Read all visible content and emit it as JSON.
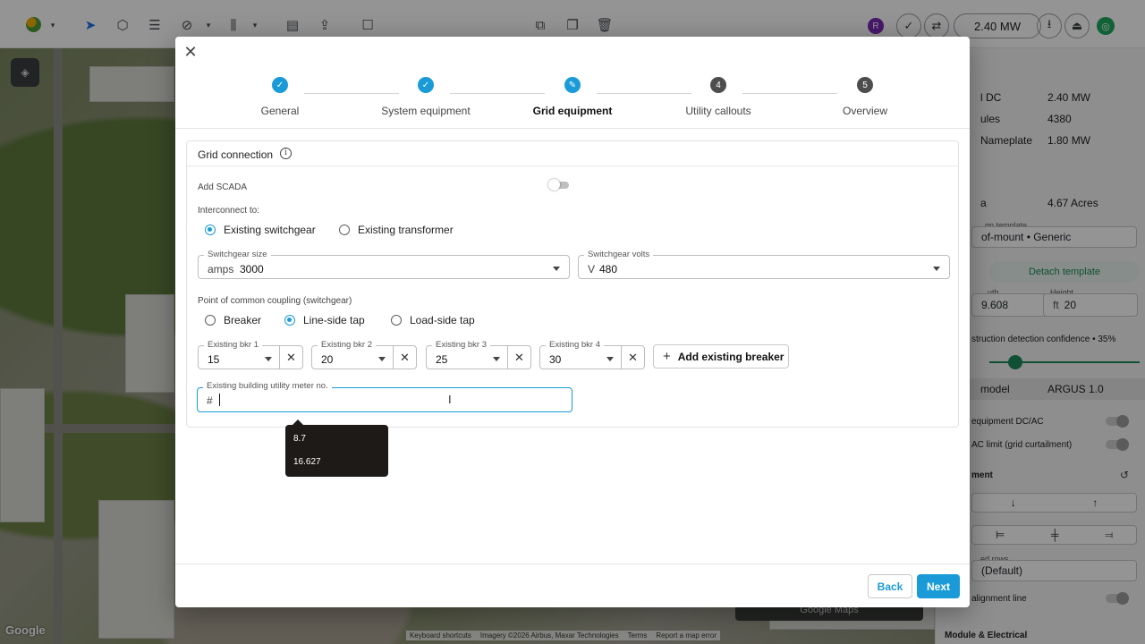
{
  "topbar": {
    "user_initial": "R",
    "capacity": "2.40 MW"
  },
  "sidepanel": {
    "rows": [
      {
        "key": "l DC",
        "value": "2.40 MW"
      },
      {
        "key": "ules",
        "value": "4380"
      },
      {
        "key": "Nameplate",
        "value": "1.80 MW"
      }
    ],
    "area_key": "a",
    "area_value": "4.67 Acres",
    "template_caption": "gn template",
    "template_value": "of-mount • Generic",
    "detach_label": "Detach template",
    "width_caption": "uth",
    "width_value": "9.608",
    "height_caption": "Height",
    "height_unit": "ft",
    "height_value": "20",
    "confidence_label": "struction detection confidence • 35%",
    "confidence_level": 0.35,
    "model_key": "model",
    "model_value": "ARGUS 1.0",
    "toggle1_label": "equipment DC/AC",
    "toggle2_label": "AC limit (grid curtailment)",
    "section_label": "ment",
    "rows_caption": "ed rows",
    "rows_value": "(Default)",
    "alignment_label": "alignment line",
    "bottom_label": "Module & Electrical"
  },
  "map": {
    "logo": "Google",
    "chip_label": "Google Maps",
    "attrib": [
      "Keyboard shortcuts",
      "Imagery ©2026 Airbus, Maxar Technologies",
      "Terms",
      "Report a map error"
    ]
  },
  "modal": {
    "steps": [
      {
        "label": "General",
        "state": "done",
        "mark": "✓"
      },
      {
        "label": "System equipment",
        "state": "done",
        "mark": "✓"
      },
      {
        "label": "Grid equipment",
        "state": "active",
        "mark": "✎"
      },
      {
        "label": "Utility callouts",
        "state": "todo",
        "mark": "4"
      },
      {
        "label": "Overview",
        "state": "todo",
        "mark": "5"
      }
    ],
    "card_title": "Grid connection",
    "add_scada_label": "Add SCADA",
    "interconnect_label": "Interconnect to:",
    "interconnect_options": [
      "Existing switchgear",
      "Existing transformer"
    ],
    "interconnect_selected": 0,
    "switchgear_size": {
      "caption": "Switchgear size",
      "unit": "amps",
      "value": "3000"
    },
    "switchgear_volts": {
      "caption": "Switchgear volts",
      "unit": "V",
      "value": "480"
    },
    "pcc_label": "Point of common coupling (switchgear)",
    "pcc_options": [
      "Breaker",
      "Line-side tap",
      "Load-side tap"
    ],
    "pcc_selected": 1,
    "breakers": [
      {
        "caption": "Existing bkr 1",
        "value": "15"
      },
      {
        "caption": "Existing bkr 2",
        "value": "20"
      },
      {
        "caption": "Existing bkr 3",
        "value": "25"
      },
      {
        "caption": "Existing bkr 4",
        "value": "30"
      }
    ],
    "add_breaker_label": "Add existing breaker",
    "meter": {
      "caption": "Existing building utility meter no.",
      "prefix": "#",
      "value": ""
    },
    "suggestions": [
      "8.7",
      "16.627"
    ],
    "back_label": "Back",
    "next_label": "Next"
  }
}
